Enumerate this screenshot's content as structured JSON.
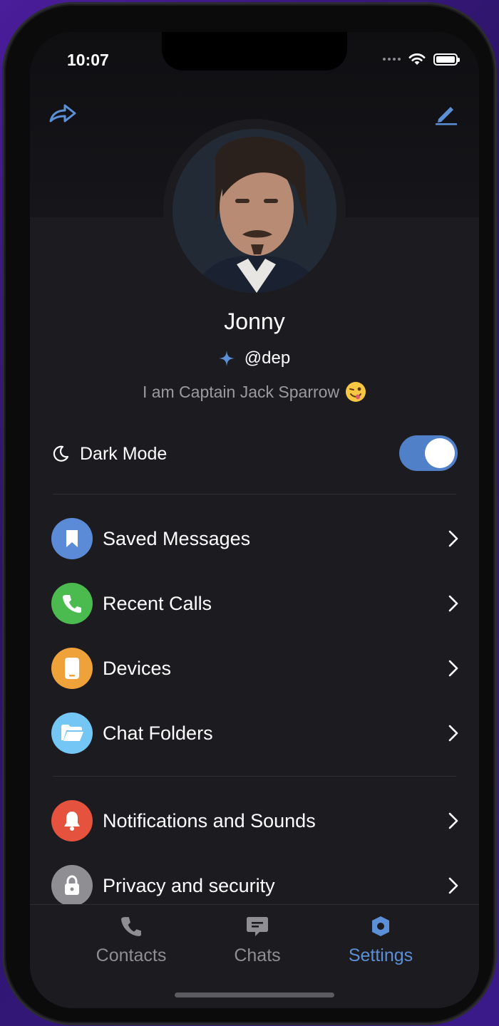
{
  "status_bar": {
    "time": "10:07"
  },
  "profile": {
    "name": "Jonny",
    "username": "@dep",
    "bio": "I am Captain Jack Sparrow"
  },
  "dark_mode": {
    "label": "Dark Mode",
    "enabled": true
  },
  "menu_group_1": [
    {
      "label": "Saved Messages",
      "icon": "bookmark-icon",
      "color": "#5b8bd6"
    },
    {
      "label": "Recent Calls",
      "icon": "phone-icon",
      "color": "#4cbb4f"
    },
    {
      "label": "Devices",
      "icon": "device-icon",
      "color": "#f0a23a"
    },
    {
      "label": "Chat Folders",
      "icon": "folder-icon",
      "color": "#74c6f5"
    }
  ],
  "menu_group_2": [
    {
      "label": "Notifications and Sounds",
      "icon": "bell-icon",
      "color": "#e5533e"
    },
    {
      "label": "Privacy and security",
      "icon": "lock-icon",
      "color": "#8e8e93"
    }
  ],
  "tabs": [
    {
      "label": "Contacts",
      "icon": "phone-icon",
      "active": false
    },
    {
      "label": "Chats",
      "icon": "chat-bubble-icon",
      "active": false
    },
    {
      "label": "Settings",
      "icon": "settings-icon",
      "active": true
    }
  ],
  "colors": {
    "accent": "#5b8fd6",
    "inactive": "#8e8e93",
    "background": "#1c1c20"
  }
}
